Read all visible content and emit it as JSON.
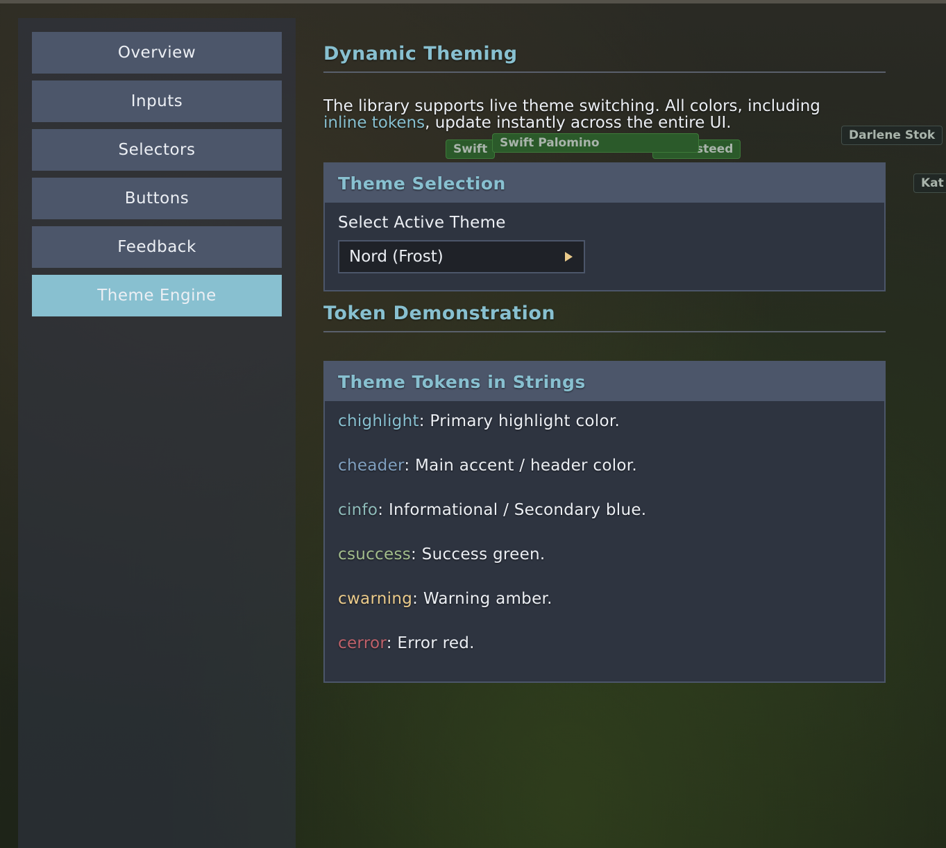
{
  "background": {
    "nameplates": [
      "Swift",
      "Swift Palomino",
      "steed",
      "Darlene Stok",
      "Kat"
    ]
  },
  "sidebar": {
    "items": [
      {
        "label": "Overview"
      },
      {
        "label": "Inputs"
      },
      {
        "label": "Selectors"
      },
      {
        "label": "Buttons"
      },
      {
        "label": "Feedback"
      },
      {
        "label": "Theme Engine",
        "active": true
      }
    ]
  },
  "main": {
    "title": "Dynamic Theming",
    "description": {
      "part1": "The library supports live theme switching. All colors, including",
      "link": "inline tokens",
      "part2": ", update instantly across the entire UI."
    },
    "theme_panel": {
      "header": "Theme Selection",
      "field_label": "Select Active Theme",
      "selected_value": "Nord (Frost)"
    },
    "token_section_title": "Token Demonstration",
    "token_panel": {
      "header": "Theme Tokens in Strings",
      "tokens": [
        {
          "name": "chighlight",
          "desc": ": Primary highlight color.",
          "color": "#88c0d0"
        },
        {
          "name": "cheader",
          "desc": ": Main accent / header color.",
          "color": "#81a1c1"
        },
        {
          "name": "cinfo",
          "desc": ": Informational / Secondary blue.",
          "color": "#8fbcbb"
        },
        {
          "name": "csuccess",
          "desc": ": Success green.",
          "color": "#a3be8c"
        },
        {
          "name": "cwarning",
          "desc": ": Warning amber.",
          "color": "#ebcb8b"
        },
        {
          "name": "cerror",
          "desc": ": Error red.",
          "color": "#bf616a"
        }
      ]
    }
  },
  "colors": {
    "accent": "#88c0d0",
    "panel_bg": "#2e3440",
    "panel_header": "#4c566a",
    "text": "#eceff4"
  }
}
